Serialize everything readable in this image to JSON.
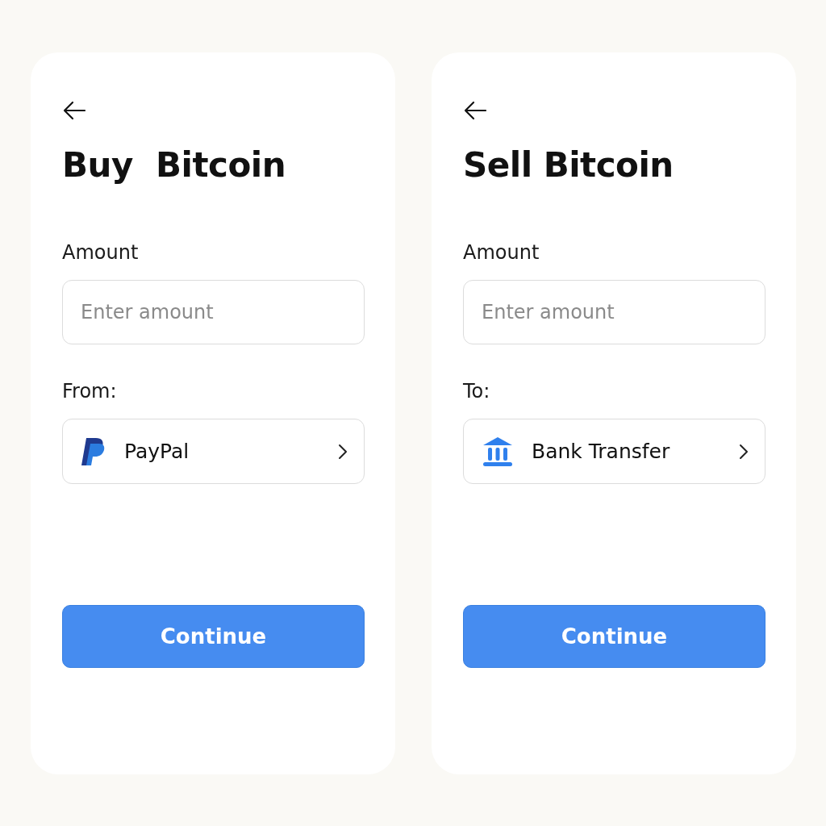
{
  "screens": [
    {
      "title": "Buy  Bitcoin",
      "amount_label": "Amount",
      "amount_field": {
        "placeholder": "Enter amount"
      },
      "method_label": "From:",
      "method": {
        "kind": "paypal",
        "label": "PayPal"
      },
      "button": "Continue"
    },
    {
      "title": "Sell Bitcoin",
      "amount_label": "Amount",
      "amount_field": {
        "placeholder": "Enter amount"
      },
      "method_label": "To:",
      "method": {
        "kind": "bank",
        "label": "Bank Transfer"
      },
      "button": "Continue"
    }
  ]
}
